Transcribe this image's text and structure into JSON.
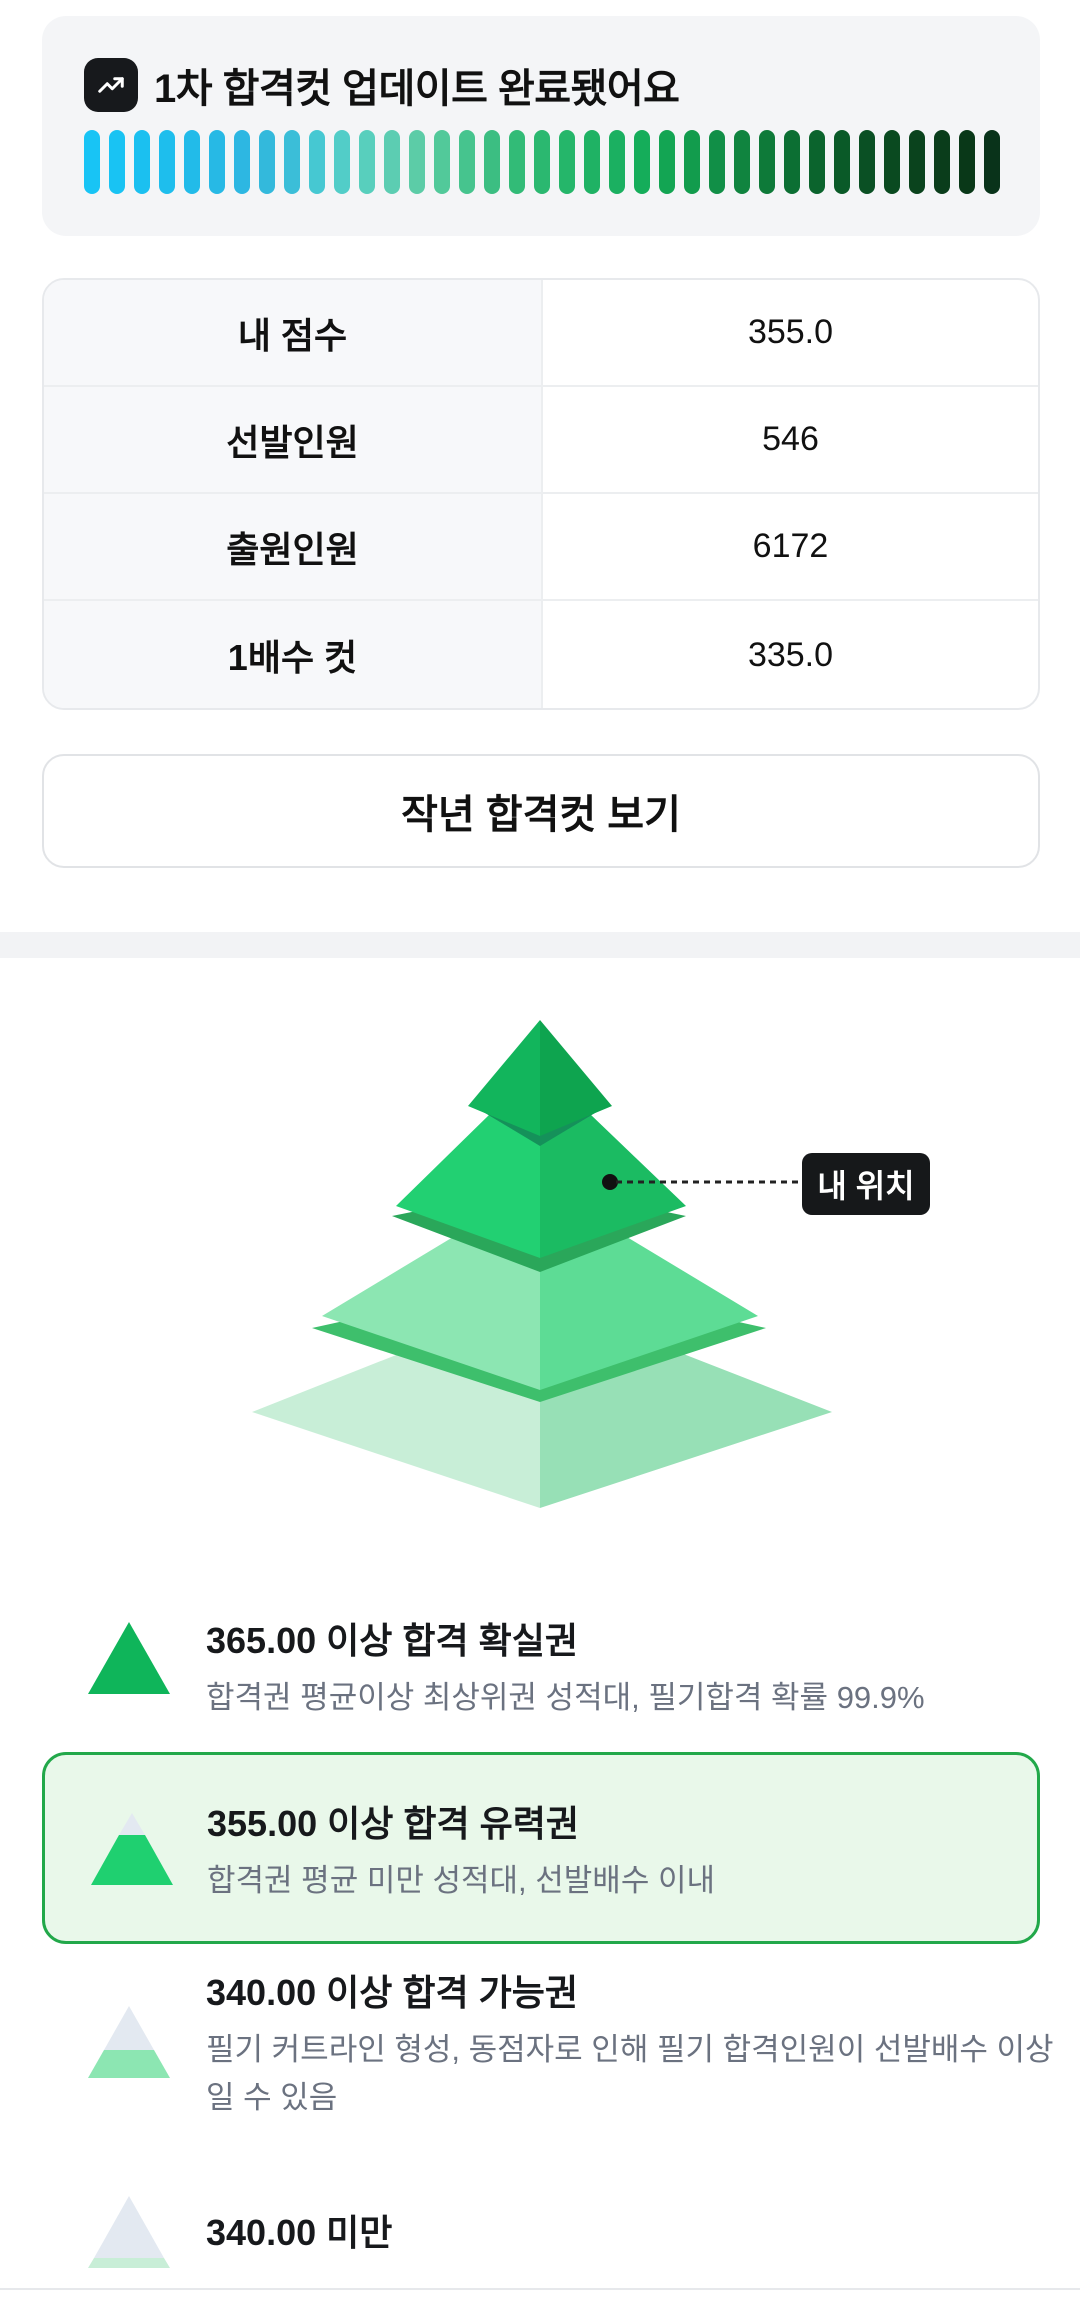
{
  "update": {
    "title": "1차 합격컷 업데이트 완료됐어요",
    "icon": "trending-up-icon",
    "bar_colors": [
      "#18c4f5",
      "#19c3f3",
      "#1bc0f0",
      "#1ebeed",
      "#22bbe9",
      "#27b9e5",
      "#2db7e2",
      "#33b9dc",
      "#3bbed8",
      "#46c8d2",
      "#52cdc8",
      "#58cfbd",
      "#5ccdb2",
      "#5ccca7",
      "#52c99a",
      "#46c48e",
      "#3cbe82",
      "#32bb77",
      "#2bb870",
      "#25b66a",
      "#1fb264",
      "#1bb061",
      "#15ad5a",
      "#13a553",
      "#129c4d",
      "#118f47",
      "#10843f",
      "#0e7a39",
      "#0c6f33",
      "#0b642d",
      "#0a5a28",
      "#0a5024",
      "#0a4a20",
      "#0a431d",
      "#0a3d1b",
      "#093818",
      "#09331a"
    ]
  },
  "stats": [
    {
      "label": "내 점수",
      "value": "355.0"
    },
    {
      "label": "선발인원",
      "value": "546"
    },
    {
      "label": "출원인원",
      "value": "6172"
    },
    {
      "label": "1배수 컷",
      "value": "335.0"
    }
  ],
  "last_year_button": "작년 합격컷 보기",
  "pyramid": {
    "my_position_label": "내 위치"
  },
  "legend": [
    {
      "title": "365.00 이상 합격 확실권",
      "desc": "합격권 평균이상 최상위권 성적대, 필기합격 확률 99.9%"
    },
    {
      "title": "355.00 이상 합격 유력권",
      "desc": "합격권 평균 미만 성적대, 선발배수 이내"
    },
    {
      "title": "340.00 이상 합격 가능권",
      "desc": "필기 커트라인 형성, 동점자로 인해 필기 합격인원이 선발배수 이상일 수 있음"
    },
    {
      "title": "340.00 미만",
      "desc": ""
    }
  ],
  "colors": {
    "tier1": "#0fb55a",
    "tier2": "#1fd070",
    "tier3": "#8ce6b2",
    "tier4": "#c8eed7",
    "highlight_bg": "#e9f8ea",
    "highlight_border": "#22a84a"
  }
}
